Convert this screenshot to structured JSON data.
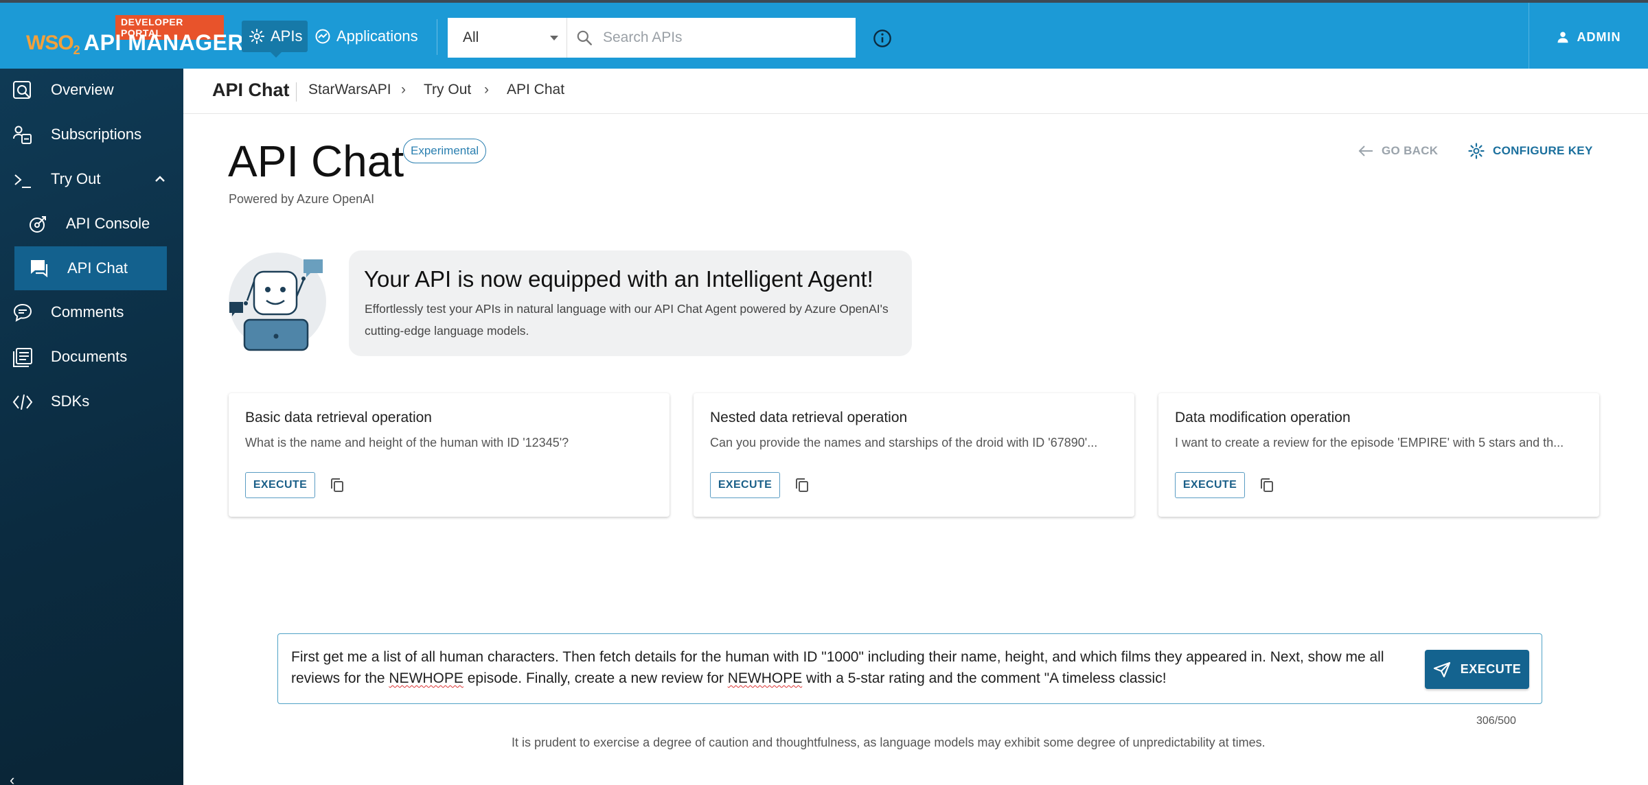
{
  "header": {
    "portal_badge": "DEVELOPER PORTAL",
    "logo_brand": "WSO",
    "logo_brand_sub": "2",
    "product_name": "API MANAGER",
    "nav": {
      "apis": "APIs",
      "applications": "Applications"
    },
    "search": {
      "scope": "All",
      "placeholder": "Search APIs"
    },
    "user": "ADMIN",
    "colors": {
      "bar": "#1c9ad6",
      "active_nav": "#1679a8",
      "badge": "#e8532b"
    }
  },
  "sidebar": {
    "items": [
      {
        "label": "Overview",
        "icon": "overview-icon"
      },
      {
        "label": "Subscriptions",
        "icon": "subscriptions-icon"
      },
      {
        "label": "Try Out",
        "icon": "terminal-icon",
        "expanded": true
      },
      {
        "label": "API Console",
        "icon": "console-icon"
      },
      {
        "label": "API Chat",
        "icon": "chat-icon",
        "active": true
      },
      {
        "label": "Comments",
        "icon": "comments-icon"
      },
      {
        "label": "Documents",
        "icon": "documents-icon"
      },
      {
        "label": "SDKs",
        "icon": "code-icon"
      }
    ],
    "collapse": "‹"
  },
  "breadcrumb": {
    "title": "API Chat",
    "items": [
      "StarWarsAPI",
      "Try Out",
      "API Chat"
    ],
    "separator": "›"
  },
  "page": {
    "title": "API Chat",
    "badge": "Experimental",
    "powered_by": "Powered by Azure OpenAI",
    "go_back": "GO BACK",
    "configure_key": "CONFIGURE KEY"
  },
  "intro": {
    "title": "Your API is now equipped with an Intelligent Agent!",
    "description": "Effortlessly test your APIs in natural language with our API Chat Agent powered by Azure OpenAI's cutting-edge language models."
  },
  "samples": [
    {
      "title": "Basic data retrieval operation",
      "query": "What is the name and height of the human with ID '12345'?",
      "action": "EXECUTE"
    },
    {
      "title": "Nested data retrieval operation",
      "query": "Can you provide the names and starships of the droid with ID '67890'...",
      "action": "EXECUTE"
    },
    {
      "title": "Data modification operation",
      "query": "I want to create a review for the episode 'EMPIRE' with 5 stars and th...",
      "action": "EXECUTE"
    }
  ],
  "chat": {
    "text_part1": "First get me a list of all human characters. Then fetch details for the human with ID \"1000\" including their name, height, and which films they appeared in. Next, show me all reviews for the ",
    "misspelled_1": "NEWHOPE",
    "text_part2": " episode. Finally, create a new review for ",
    "misspelled_2": "NEWHOPE",
    "text_part3": " with a 5-star rating and the comment \"A timeless classic!",
    "execute": "EXECUTE",
    "char_count": "306/500",
    "disclaimer": "It is prudent to exercise a degree of caution and thoughtfulness, as language models may exhibit some degree of unpredictability at times."
  }
}
